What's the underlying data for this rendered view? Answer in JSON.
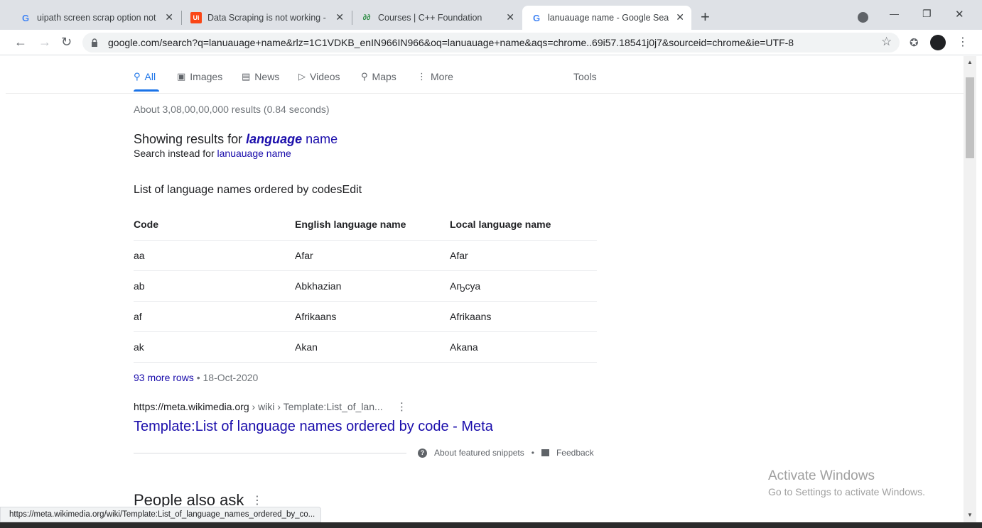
{
  "tabs": [
    {
      "favicon": "G",
      "title": "uipath screen scrap option not visible",
      "close": "✕"
    },
    {
      "favicon": "Ui",
      "title": "Data Scraping is not working - Help",
      "close": "✕"
    },
    {
      "favicon": "∂∂",
      "title": "Courses | C++ Foundation",
      "close": "✕"
    },
    {
      "favicon": "G",
      "title": "lanuauage name - Google Search",
      "close": "✕"
    }
  ],
  "new_tab": "+",
  "window": {
    "minimize": "—",
    "restore": "❐",
    "close": "✕"
  },
  "address": {
    "url": "google.com/search?q=lanuauage+name&rlz=1C1VDKB_enIN966IN966&oq=lanuauage+name&aqs=chrome..69i57.18541j0j7&sourceid=chrome&ie=UTF-8"
  },
  "search_tabs": [
    {
      "icon": "search-icon",
      "label": "All"
    },
    {
      "icon": "images-icon",
      "label": "Images"
    },
    {
      "icon": "news-icon",
      "label": "News"
    },
    {
      "icon": "videos-icon",
      "label": "Videos"
    },
    {
      "icon": "maps-icon",
      "label": "Maps"
    },
    {
      "icon": "more-icon",
      "label": "More"
    }
  ],
  "tools_label": "Tools",
  "result_stats": "About 3,08,00,00,000 results (0.84 seconds)",
  "spell": {
    "showing_prefix": "Showing results for ",
    "corrected_bold": "language",
    "corrected_rest": " name",
    "instead_prefix": "Search instead for ",
    "original": "lanuauage name"
  },
  "snippet": {
    "heading": "List of language names ordered by codesEdit",
    "columns": [
      "Code",
      "English language name",
      "Local language name"
    ],
    "rows": [
      [
        "aa",
        "Afar",
        "Afar"
      ],
      [
        "ab",
        "Abkhazian",
        "Аҧсуа"
      ],
      [
        "af",
        "Afrikaans",
        "Afrikaans"
      ],
      [
        "ak",
        "Akan",
        "Akana"
      ]
    ],
    "more_rows": "93 more rows",
    "date": "18-Oct-2020",
    "source_url": "https://meta.wikimedia.org",
    "breadcrumb": " › wiki › Template:List_of_lan...",
    "title": "Template:List of language names ordered by code - Meta",
    "about": "About featured snippets",
    "feedback": "Feedback"
  },
  "people_also_ask": "People also ask",
  "status_url": "https://meta.wikimedia.org/wiki/Template:List_of_language_names_ordered_by_co...",
  "watermark": {
    "title": "Activate Windows",
    "sub": "Go to Settings to activate Windows."
  }
}
